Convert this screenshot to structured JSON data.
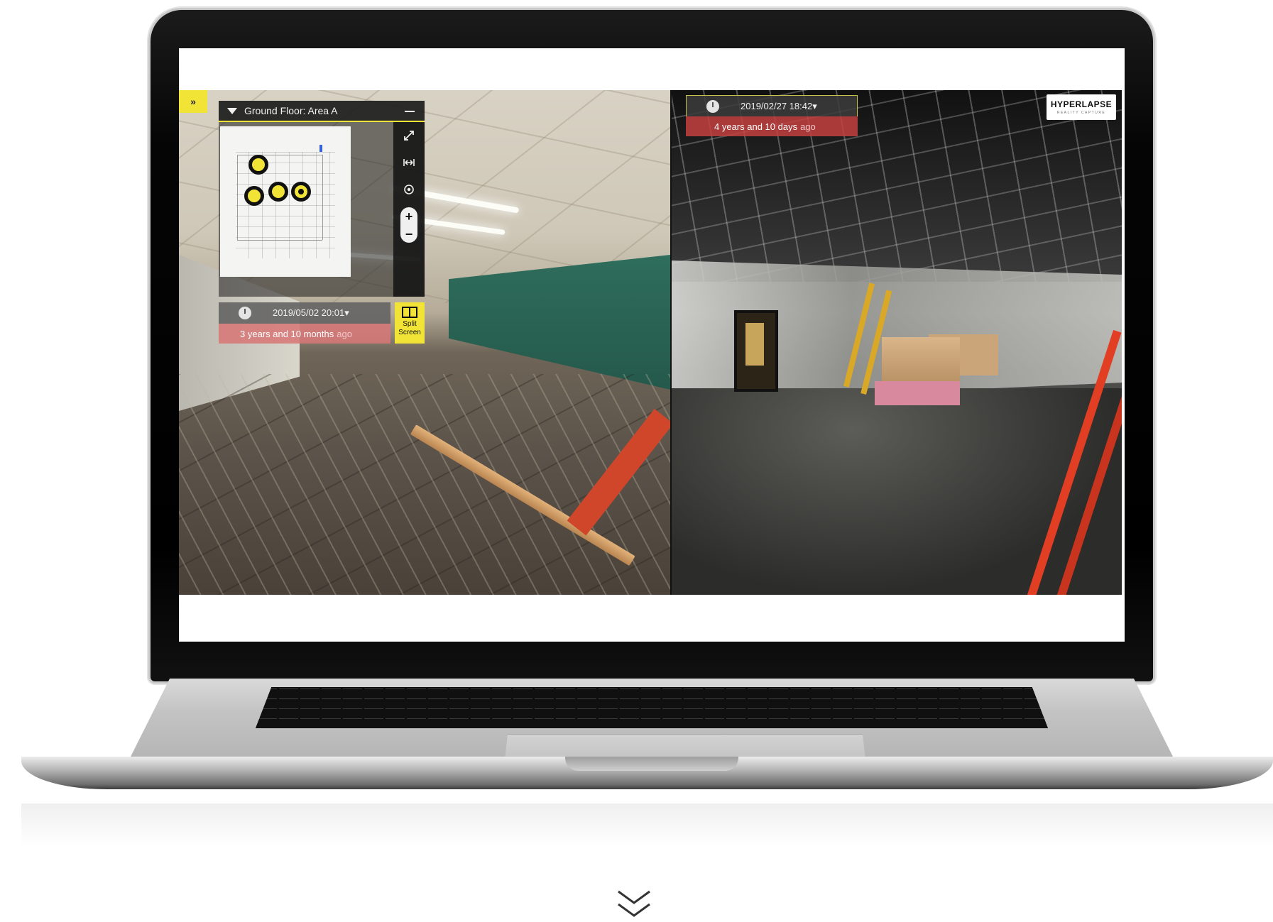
{
  "viewer": {
    "expand_label": "»",
    "floor_panel": {
      "title": "Ground Floor: Area A",
      "tools": [
        "fullscreen-icon",
        "measure-icon",
        "locate-icon",
        "zoom-in-icon",
        "zoom-out-icon"
      ],
      "zoom_in": "+",
      "zoom_out": "−"
    },
    "left_capture": {
      "timestamp": "2019/05/02 20:01▾",
      "age": "3 years and 10 months",
      "ago": "ago"
    },
    "split_button": {
      "line1": "Split",
      "line2": "Screen"
    },
    "right_capture": {
      "timestamp": "2019/02/27 18:42▾",
      "age": "4 years and 10 days",
      "ago": "ago"
    },
    "logo": {
      "name": "HYPERLAPSE",
      "tagline": "REALITY CAPTURE"
    }
  },
  "colors": {
    "accent": "#f1e437",
    "age_badge_left": "#d67878",
    "age_badge_right": "#c44040"
  },
  "page": {
    "scroll_icon": "double-chevron-down-icon"
  }
}
